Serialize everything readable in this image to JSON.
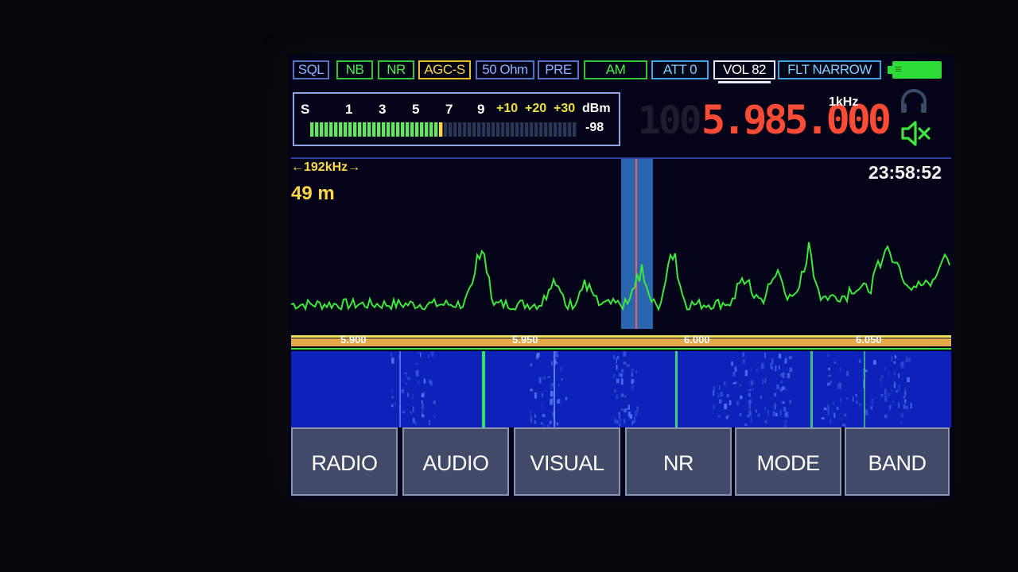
{
  "status_chips": [
    {
      "label": "SQL",
      "style": "blue"
    },
    {
      "label": "NB",
      "style": "green"
    },
    {
      "label": "NR",
      "style": "green"
    },
    {
      "label": "AGC-S",
      "style": "yellow"
    },
    {
      "label": "50 Ohm",
      "style": "blue"
    },
    {
      "label": "PRE",
      "style": "blue"
    },
    {
      "label": "AM",
      "style": "green"
    },
    {
      "label": "ATT 0",
      "style": "cyan"
    },
    {
      "label": "VOL 82",
      "style": "white"
    },
    {
      "label": "FLT NARROW",
      "style": "cyan"
    }
  ],
  "battery": {
    "icon": "battery-icon",
    "color": "#2ddc36"
  },
  "smeter": {
    "scale_labels": [
      "S",
      "1",
      "3",
      "5",
      "7",
      "9",
      "+10",
      "+20",
      "+30"
    ],
    "unit": "dBm",
    "value": "-98",
    "level_fraction": 0.48,
    "peak_fraction": 0.49
  },
  "frequency": {
    "ghost_digits": "100",
    "display": "5.985.000",
    "step": "1kHz",
    "color": "#ff4a36"
  },
  "spectrum": {
    "bandwidth_label": "←192kHz→",
    "band": "49 m",
    "clock": "23:58:52",
    "scale_ticks": [
      "5.900",
      "5.950",
      "6.000",
      "6.050"
    ],
    "trace_color": "#3ee63e"
  },
  "menu_buttons": [
    "RADIO",
    "AUDIO",
    "VISUAL",
    "NR",
    "MODE",
    "BAND"
  ],
  "icons": [
    "headphones-icon",
    "speaker-icon",
    "battery-icon"
  ]
}
